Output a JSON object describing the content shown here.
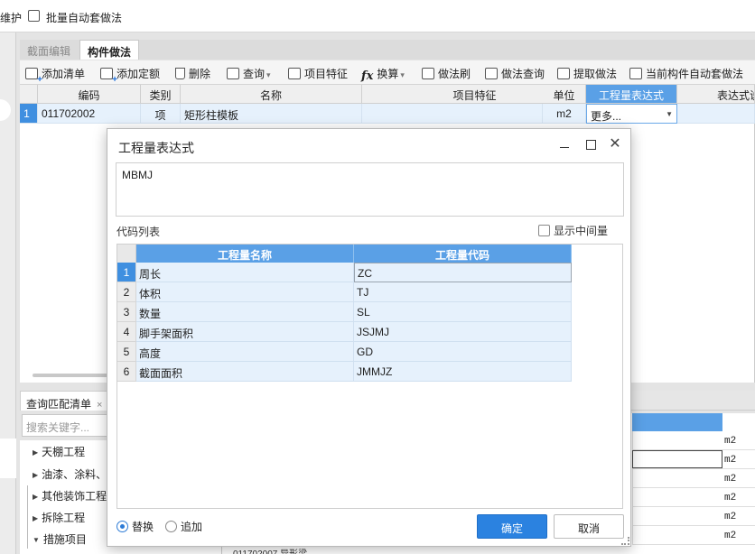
{
  "topbar": {
    "left_text": "维护",
    "batch_label": "批量自动套做法"
  },
  "tabs": [
    {
      "label": "截面编辑",
      "active": false
    },
    {
      "label": "构件做法",
      "active": true
    }
  ],
  "toolbar": {
    "add_list": "添加清单",
    "add_quota": "添加定额",
    "delete": "删除",
    "query": "查询",
    "item_feature": "项目特征",
    "convert": "换算",
    "method_brush": "做法刷",
    "method_query": "做法查询",
    "extract_method": "提取做法",
    "auto_apply": "当前构件自动套做法"
  },
  "grid": {
    "headers": [
      "编码",
      "类别",
      "名称",
      "项目特征",
      "单位",
      "工程量表达式",
      "表达式说"
    ],
    "rows": [
      {
        "num": "1",
        "code": "011702002",
        "type": "项",
        "name": "矩形柱模板",
        "feature": "",
        "unit": "m2",
        "expr": "更多..."
      }
    ]
  },
  "bottom_panel": {
    "tab_label": "查询匹配清单",
    "tab_close": "×",
    "search_placeholder": "搜索关键字...",
    "tree": [
      {
        "label": "天棚工程",
        "expanded": false
      },
      {
        "label": "油漆、涂料、",
        "expanded": false
      },
      {
        "label": "其他装饰工程",
        "expanded": false
      },
      {
        "label": "拆除工程",
        "expanded": false
      },
      {
        "label": "措施项目",
        "expanded": true
      }
    ],
    "right_units": [
      "m2",
      "m2",
      "m2",
      "m2",
      "m2",
      "m2"
    ],
    "partial_row": "011702007   异形梁"
  },
  "dialog": {
    "title": "工程量表达式",
    "expression_value": "MBMJ",
    "code_list_label": "代码列表",
    "show_intermediate_label": "显示中间量",
    "table_headers": [
      "工程量名称",
      "工程量代码"
    ],
    "rows": [
      {
        "num": "1",
        "name": "周长",
        "code": "ZC"
      },
      {
        "num": "2",
        "name": "体积",
        "code": "TJ"
      },
      {
        "num": "3",
        "name": "数量",
        "code": "SL"
      },
      {
        "num": "4",
        "name": "脚手架面积",
        "code": "JSJMJ"
      },
      {
        "num": "5",
        "name": "高度",
        "code": "GD"
      },
      {
        "num": "6",
        "name": "截面面积",
        "code": "JMMJZ"
      }
    ],
    "radio_replace": "替换",
    "radio_append": "追加",
    "ok_label": "确定",
    "cancel_label": "取消"
  },
  "colors": {
    "accent": "#2b82e0",
    "header_blue": "#5aa0e6",
    "row_blue": "#e6f1fc"
  }
}
